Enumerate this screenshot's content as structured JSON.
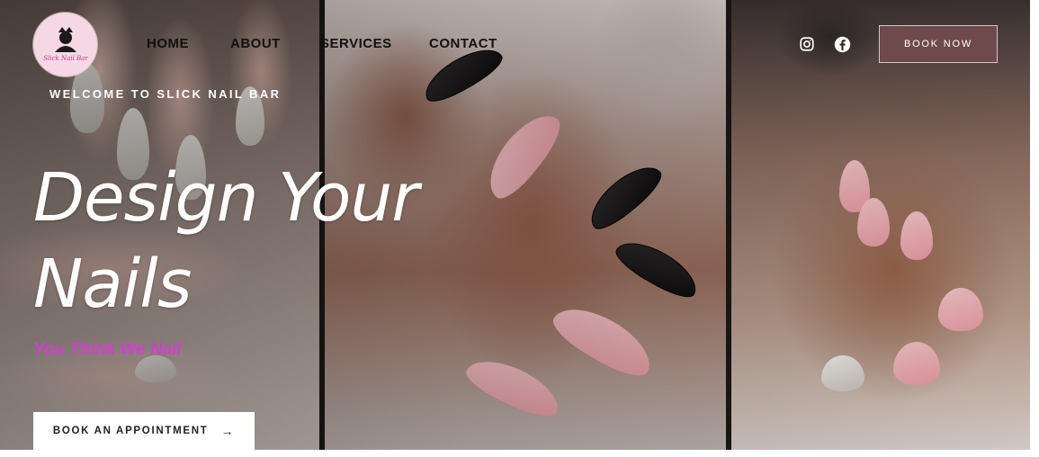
{
  "brand": {
    "logo_icon": "slick-nail-bar-logo",
    "logo_text": "Slick Nail Bar"
  },
  "nav": {
    "items": [
      {
        "label": "HOME"
      },
      {
        "label": "ABOUT"
      },
      {
        "label": "SERVICES"
      },
      {
        "label": "CONTACT"
      }
    ]
  },
  "social": {
    "instagram_icon": "instagram-icon",
    "facebook_icon": "facebook-icon"
  },
  "header": {
    "book_now_label": "BOOK NOW"
  },
  "hero": {
    "welcome": "WELCOME TO SLICK NAIL BAR",
    "headline_line1": "Design Your",
    "headline_line2": "Nails",
    "tagline": "You Think We Nail",
    "cta_label": "BOOK AN APPOINTMENT",
    "cta_arrow": "→"
  },
  "colors": {
    "accent": "#6e4a4a",
    "tagline": "#d13fcf",
    "logo_bg": "#f6d7e4"
  }
}
